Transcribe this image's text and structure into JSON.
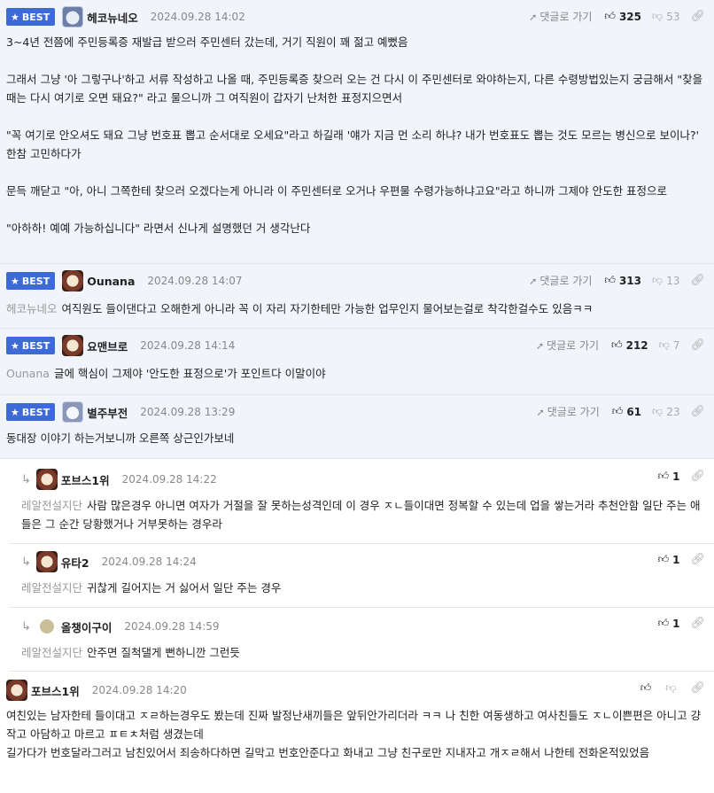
{
  "labels": {
    "best": "BEST",
    "reply_link": "댓글로 가기"
  },
  "comments": [
    {
      "nick": "헤코뉴네오",
      "date": "2024.09.28 14:02",
      "up": "325",
      "down": "53",
      "lines": [
        "3~4년 전쯤에 주민등록증 재발급 받으러 주민센터 갔는데, 거기 직원이 꽤 젊고 예뻤음",
        "",
        "그래서 그냥 '아 그렇구나'하고 서류 작성하고 나올 때, 주민등록증 찾으러 오는 건 다시 이 주민센터로 와야하는지, 다른 수령방법있는지 궁금해서 \"찾을 때는 다시 여기로 오면 돼요?\" 라고 물으니까 그 여직원이 갑자기 난처한 표정지으면서",
        "",
        "\"꼭 여기로 안오셔도 돼요 그냥 번호표 뽑고 순서대로 오세요\"라고 하길래 '얘가 지금 먼 소리 하냐? 내가 번호표도 뽑는 것도 모르는 병신으로 보이나?' 한참 고민하다가",
        "",
        "문득 깨닫고 \"아, 아니 그쪽한테 찾으러 오겠다는게 아니라 이 주민센터로 오거나 우편물 수령가능하냐고요\"라고 하니까 그제야 안도한 표정으로",
        "",
        "\"아하하! 예예 가능하십니다\" 라면서 신나게 설명했던 거 생각난다"
      ]
    },
    {
      "nick": "Ounana",
      "date": "2024.09.28 14:07",
      "up": "313",
      "down": "13",
      "mention": "헤코뉴네오",
      "text": "여직원도 들이댄다고 오해한게 아니라 꼭 이 자리 자기한테만 가능한 업무인지 물어보는걸로 착각한걸수도 있음ㅋㅋ"
    },
    {
      "nick": "요맨브로",
      "date": "2024.09.28 14:14",
      "up": "212",
      "down": "7",
      "mention": "Ounana",
      "text": "글에 핵심이 그제야 '안도한 표정으로'가 포인트다 이말이야"
    },
    {
      "nick": "별주부전",
      "date": "2024.09.28 13:29",
      "up": "61",
      "down": "23",
      "text": "동대장 이야기 하는거보니까 오른쪽 상근인가보네"
    }
  ],
  "replies": [
    {
      "nick": "포브스1위",
      "date": "2024.09.28 14:22",
      "up": "1",
      "mention": "레알전설지단",
      "text": "사람 많은경우 아니면 여자가 거절을 잘 못하는성격인데 이 경우 ㅈㄴ들이대면 정복할 수 있는데 업을 쌓는거라 추천안함 일단 주는 애들은 그 순간 당황했거나 거부못하는 경우라"
    },
    {
      "nick": "유타2",
      "date": "2024.09.28 14:24",
      "up": "1",
      "mention": "레알전설지단",
      "text": "귀찮게 길어지는 거 싫어서 일단 주는 경우"
    },
    {
      "nick": "올챙이구이",
      "date": "2024.09.28 14:59",
      "up": "1",
      "mention": "레알전설지단",
      "text": "안주면 질척댈게 뻔하니깐 그런듯"
    }
  ],
  "last": {
    "nick": "포브스1위",
    "date": "2024.09.28 14:20",
    "lines": [
      "여친있는 남자한테 들이대고 ㅈㄹ하는경우도 봤는데 진짜 발정난새끼들은 앞뒤안가리더라 ㅋㅋ 나 친한 여동생하고 여사친들도 ㅈㄴ이쁜편은 아니고 걍 작고 아담하고 마르고 ㅍㅌㅊ처럼 생겼는데",
      "길가다가 번호달라그러고 남친있어서 죄송하다하면 길막고 번호안준다고 화내고 그냥 친구로만 지내자고 개ㅈㄹ해서 나한테 전화온적있었음"
    ]
  }
}
